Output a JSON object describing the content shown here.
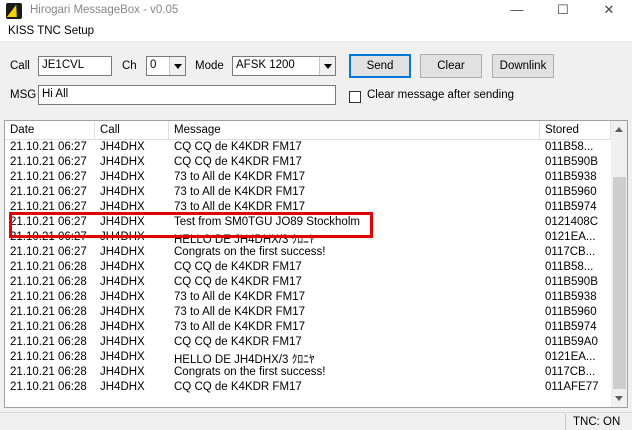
{
  "window": {
    "title": "Hirogari MessageBox - v0.05",
    "min_glyph": "—",
    "max_glyph": "☐",
    "close_glyph": "✕"
  },
  "menu": {
    "items": [
      "KISS TNC Setup"
    ]
  },
  "form": {
    "call_label": "Call",
    "call_value": "JE1CVL",
    "ch_label": "Ch",
    "ch_value": "0",
    "mode_label": "Mode",
    "mode_value": "AFSK 1200",
    "msg_label": "MSG",
    "msg_value": "Hi All",
    "send_label": "Send",
    "clear_label": "Clear",
    "downlink_label": "Downlink",
    "clear_after_send_label": "Clear message after sending",
    "clear_after_send_checked": false
  },
  "table": {
    "columns": [
      "Date",
      "Call",
      "Message",
      "Stored"
    ],
    "rows": [
      [
        "21.10.21 06:27",
        "JH4DHX",
        "CQ CQ de K4KDR FM17",
        "011B58..."
      ],
      [
        "21.10.21 06:27",
        "JH4DHX",
        "CQ CQ de K4KDR FM17",
        "011B590B"
      ],
      [
        "21.10.21 06:27",
        "JH4DHX",
        "73 to All de K4KDR FM17",
        "011B5938"
      ],
      [
        "21.10.21 06:27",
        "JH4DHX",
        "73 to All de K4KDR FM17",
        "011B5960"
      ],
      [
        "21.10.21 06:27",
        "JH4DHX",
        "73 to All de K4KDR FM17",
        "011B5974"
      ],
      [
        "21.10.21 06:27",
        "JH4DHX",
        "Test from SM0TGU JO89 Stockholm",
        "0121408C"
      ],
      [
        "21.10.21 06:27",
        "JH4DHX",
        "HELLO DE JH4DHX/3 ｸﾛﾆﾔ",
        "0121EA..."
      ],
      [
        "21.10.21 06:27",
        "JH4DHX",
        "Congrats on the first success!",
        "0117CB..."
      ],
      [
        "21.10.21 06:28",
        "JH4DHX",
        "CQ CQ de K4KDR FM17",
        "011B58..."
      ],
      [
        "21.10.21 06:28",
        "JH4DHX",
        "CQ CQ de K4KDR FM17",
        "011B590B"
      ],
      [
        "21.10.21 06:28",
        "JH4DHX",
        "73 to All de K4KDR FM17",
        "011B5938"
      ],
      [
        "21.10.21 06:28",
        "JH4DHX",
        "73 to All de K4KDR FM17",
        "011B5960"
      ],
      [
        "21.10.21 06:28",
        "JH4DHX",
        "73 to All de K4KDR FM17",
        "011B5974"
      ],
      [
        "21.10.21 06:28",
        "JH4DHX",
        "CQ CQ de K4KDR FM17",
        "011B59A0"
      ],
      [
        "21.10.21 06:28",
        "JH4DHX",
        "HELLO DE JH4DHX/3 ｸﾛﾆﾔ",
        "0121EA..."
      ],
      [
        "21.10.21 06:28",
        "JH4DHX",
        "Congrats on the first success!",
        "0117CB..."
      ],
      [
        "21.10.21 06:28",
        "JH4DHX",
        "CQ CQ de K4KDR FM17",
        "011AFE77"
      ]
    ],
    "highlighted_row": 5,
    "highlight_color": "#e00000"
  },
  "status": {
    "tnc": "TNC: ON"
  },
  "icons": {
    "app": "lightning-bolt-icon"
  }
}
